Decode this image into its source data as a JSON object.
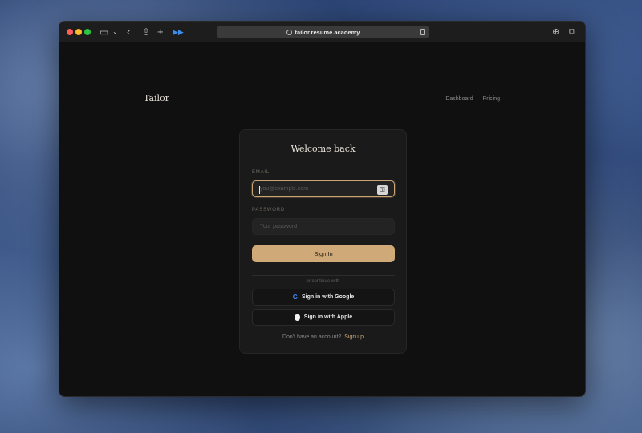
{
  "browser": {
    "url": "tailor.resume.academy"
  },
  "header": {
    "logo": "Tailor",
    "nav": [
      {
        "label": "Dashboard"
      },
      {
        "label": "Pricing"
      }
    ]
  },
  "card": {
    "title": "Welcome back",
    "email": {
      "label": "EMAIL",
      "placeholder": "you@example.com",
      "value": ""
    },
    "password": {
      "label": "PASSWORD",
      "placeholder": "Your password",
      "value": ""
    },
    "signin_label": "Sign In",
    "divider_text": "or continue with",
    "google_label": "Sign in with Google",
    "apple_label": "Sign in with Apple",
    "footer_prompt": "Don't have an account?",
    "signup_label": "Sign up"
  },
  "colors": {
    "accent": "#cfa978",
    "background": "#101010",
    "card": "#1a1a1a"
  }
}
